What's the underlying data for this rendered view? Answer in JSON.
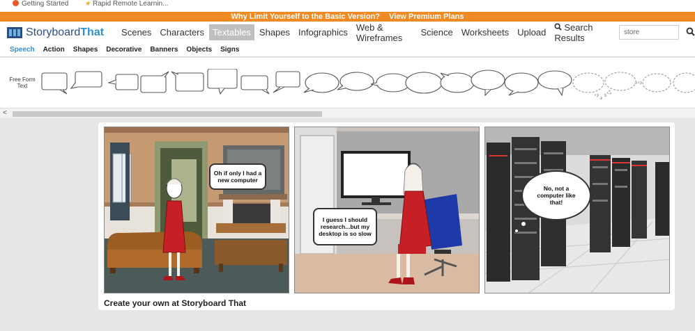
{
  "browser": {
    "bookmarks": [
      "Getting Started",
      "Rapid Remote Learnin..."
    ]
  },
  "promo": {
    "text": "Why Limit Yourself to the Basic Version?",
    "link": "View Premium Plans",
    "color": "#f08a24"
  },
  "nav": {
    "logo_part1": "Storyboard",
    "logo_part2": "That",
    "items": [
      "Scenes",
      "Characters",
      "Textables",
      "Shapes",
      "Infographics",
      "Web & Wireframes",
      "Science",
      "Worksheets",
      "Upload"
    ],
    "active": "Textables",
    "search_results_label": "Search Results",
    "search_value": "store",
    "search_icon": "search-icon"
  },
  "subtabs": {
    "items": [
      "Speech",
      "Action",
      "Shapes",
      "Decorative",
      "Banners",
      "Objects",
      "Signs"
    ],
    "active": "Speech"
  },
  "palette": {
    "free_form_label": "Free Form Text",
    "scroll_left": "<"
  },
  "storyboard": {
    "panels": [
      {
        "scene": "living room",
        "bubble": "Oh if only I had a new computer"
      },
      {
        "scene": "office cubicle",
        "bubble": "I guess I should research...but my desktop is so slow"
      },
      {
        "scene": "server room",
        "bubble": "No, not a computer like that!"
      }
    ],
    "caption": "Create your own at Storyboard That"
  }
}
